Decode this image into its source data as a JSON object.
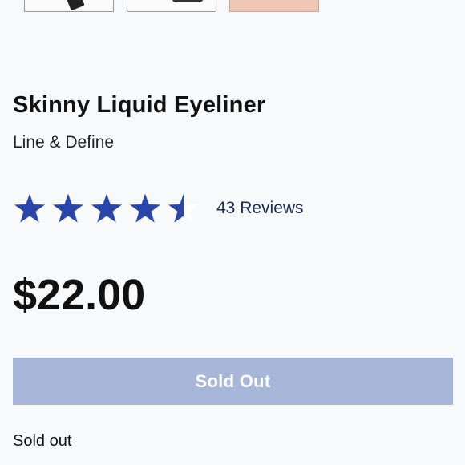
{
  "product": {
    "title": "Skinny Liquid Eyeliner",
    "subtitle": "Line & Define",
    "price": "$22.00",
    "rating": {
      "value": 4.5,
      "max": 5,
      "reviews_label": "43 Reviews"
    },
    "cta_label": "Sold Out",
    "stock_status": "Sold out"
  },
  "colors": {
    "star": "#2a45a8",
    "button": "#a7b6d9",
    "reviews_text": "#1f2a52"
  },
  "icons": {
    "star": "star-icon"
  }
}
